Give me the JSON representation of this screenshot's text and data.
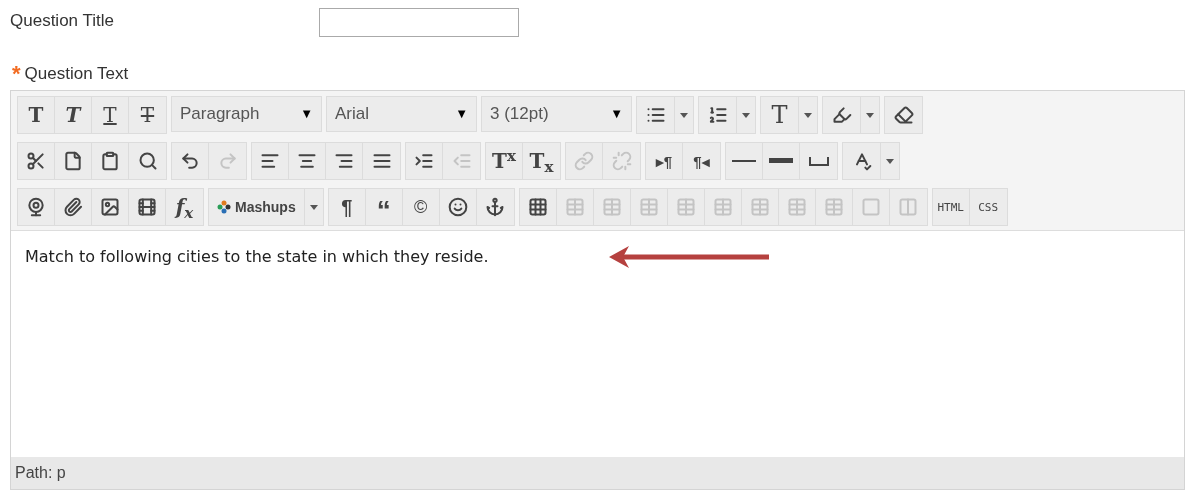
{
  "title_field": {
    "label": "Question Title"
  },
  "text_field": {
    "required_mark": "*",
    "label": "Question Text"
  },
  "toolbar": [
    [
      {
        "kind": "buttons",
        "items": [
          {
            "kind": "bold",
            "label": "T",
            "disabled": false
          },
          {
            "kind": "italic",
            "label": "T",
            "disabled": false
          },
          {
            "kind": "underline",
            "label": "T",
            "disabled": false
          },
          {
            "kind": "strike",
            "label": "T",
            "disabled": false
          }
        ]
      },
      {
        "kind": "select",
        "value": "Paragraph",
        "caret": "▼"
      },
      {
        "kind": "select",
        "value": "Arial",
        "caret": "▼"
      },
      {
        "kind": "select",
        "value": "3 (12pt)",
        "caret": "▼"
      },
      {
        "kind": "split",
        "items": [
          {
            "kind": "bullets",
            "disabled": false
          }
        ]
      },
      {
        "kind": "split",
        "items": [
          {
            "kind": "numbered",
            "disabled": false
          }
        ]
      },
      {
        "kind": "split",
        "items": [
          {
            "kind": "textcolor",
            "label": "T",
            "disabled": false
          }
        ]
      },
      {
        "kind": "split",
        "items": [
          {
            "kind": "highlighter",
            "disabled": false
          }
        ]
      },
      {
        "kind": "buttons",
        "items": [
          {
            "kind": "eraser",
            "disabled": false
          }
        ]
      }
    ],
    [
      {
        "kind": "buttons",
        "items": [
          {
            "kind": "cut",
            "disabled": false
          },
          {
            "kind": "page",
            "disabled": false
          },
          {
            "kind": "paste",
            "disabled": false
          },
          {
            "kind": "find",
            "disabled": false
          }
        ]
      },
      {
        "kind": "buttons",
        "items": [
          {
            "kind": "undo",
            "disabled": false
          },
          {
            "kind": "redo",
            "disabled": true
          }
        ]
      },
      {
        "kind": "buttons",
        "items": [
          {
            "kind": "left",
            "disabled": false
          },
          {
            "kind": "center",
            "disabled": false
          },
          {
            "kind": "right",
            "disabled": false
          },
          {
            "kind": "justify",
            "disabled": false
          }
        ]
      },
      {
        "kind": "buttons",
        "items": [
          {
            "kind": "indent",
            "disabled": false
          },
          {
            "kind": "outdent",
            "disabled": true
          }
        ]
      },
      {
        "kind": "buttons",
        "items": [
          {
            "kind": "sup",
            "label": "T$^{x}$",
            "disabled": false
          },
          {
            "kind": "sub",
            "label": "T$_{x}$",
            "disabled": false
          }
        ]
      },
      {
        "kind": "buttons",
        "items": [
          {
            "kind": "link",
            "disabled": true
          },
          {
            "kind": "unlink",
            "disabled": true
          }
        ]
      },
      {
        "kind": "buttons",
        "items": [
          {
            "kind": "ltr",
            "label": "▸¶",
            "disabled": false
          },
          {
            "kind": "rtl",
            "label": "¶◂",
            "disabled": false
          }
        ]
      },
      {
        "kind": "buttons",
        "items": [
          {
            "kind": "rule",
            "disabled": false
          },
          {
            "kind": "thickrule",
            "disabled": false
          },
          {
            "kind": "space",
            "disabled": false
          }
        ]
      },
      {
        "kind": "split",
        "items": [
          {
            "kind": "spell",
            "disabled": false
          }
        ]
      }
    ],
    [
      {
        "kind": "buttons",
        "items": [
          {
            "kind": "webcam",
            "disabled": false
          },
          {
            "kind": "attach",
            "disabled": false
          },
          {
            "kind": "image",
            "disabled": false
          },
          {
            "kind": "video",
            "disabled": false
          },
          {
            "kind": "formula",
            "label": "f$_{x}$",
            "disabled": false
          }
        ]
      },
      {
        "kind": "split",
        "items": [
          {
            "kind": "mashups",
            "label": "Mashups",
            "disabled": false
          }
        ]
      },
      {
        "kind": "buttons",
        "items": [
          {
            "kind": "pilcrow",
            "label": "¶",
            "disabled": false
          },
          {
            "kind": "quote",
            "label": "“",
            "disabled": false
          },
          {
            "kind": "copyright",
            "label": "©",
            "disabled": false
          },
          {
            "kind": "smiley",
            "disabled": false
          },
          {
            "kind": "anchor",
            "disabled": false
          }
        ]
      },
      {
        "kind": "buttons",
        "items": [
          {
            "kind": "table",
            "disabled": false
          },
          {
            "kind": "tablecell",
            "disabled": true
          },
          {
            "kind": "tablecell",
            "disabled": true
          },
          {
            "kind": "tablecell",
            "disabled": true
          },
          {
            "kind": "tablecell",
            "disabled": true
          },
          {
            "kind": "tablecell",
            "disabled": true
          },
          {
            "kind": "tablecell",
            "disabled": true
          },
          {
            "kind": "tablecell",
            "disabled": true
          },
          {
            "kind": "tablecell",
            "disabled": true
          },
          {
            "kind": "cell",
            "disabled": true
          },
          {
            "kind": "splitcell",
            "disabled": true
          }
        ]
      },
      {
        "kind": "buttons",
        "items": [
          {
            "kind": "code",
            "label": "HTML",
            "disabled": false
          },
          {
            "kind": "code",
            "label": "CSS",
            "disabled": false
          }
        ]
      }
    ]
  ],
  "content": "Match to following cities to the state in which they reside.",
  "path": "Path: p"
}
